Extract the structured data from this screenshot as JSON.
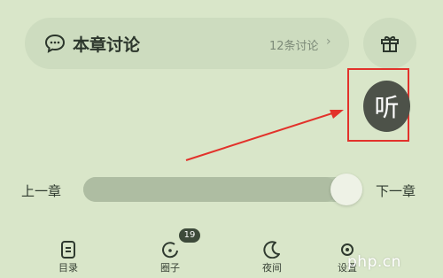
{
  "discussion": {
    "title": "本章讨论",
    "count": "12条讨论",
    "chevron": "›",
    "icon": "chat-bubble-icon"
  },
  "gift": {
    "icon": "gift-icon"
  },
  "listen": {
    "label": "听"
  },
  "chapter_nav": {
    "prev_label": "上一章",
    "next_label": "下一章",
    "progress": 0.92
  },
  "tabs": [
    {
      "label": "目录",
      "icon": "catalog-icon"
    },
    {
      "label": "圈子",
      "icon": "circle-icon",
      "badge": "19"
    },
    {
      "label": "夜间",
      "icon": "moon-icon"
    },
    {
      "label": "设置",
      "icon": "settings-icon"
    }
  ],
  "watermark": "php.cn",
  "colors": {
    "background": "#d9e6c9",
    "pill": "#cddcbf",
    "listen_button": "#4d5249",
    "annotation_red": "#e2322b"
  }
}
